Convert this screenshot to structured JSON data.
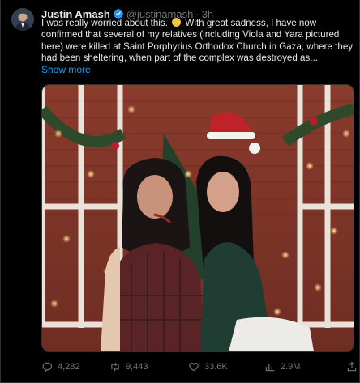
{
  "tweet": {
    "author_name": "Justin Amash",
    "handle": "@justinamash",
    "separator": "·",
    "time": "3h",
    "text_line1_a": "I was really worried about this.",
    "text_line1_b": "With great sadness, I have now confirmed that",
    "text_rest": "several of my relatives (including Viola and Yara pictured here) were killed at Saint Porphyrius Orthodox Church in Gaza, where they had been sheltering, when part of the complex was destroyed as...",
    "show_more": "Show more",
    "emoji_name": "pensive-face-emoji"
  },
  "actions": {
    "replies": "4,282",
    "retweets": "9,443",
    "likes": "33.6K",
    "views": "2.9M"
  },
  "icons": [
    "verified-badge-icon",
    "reply-icon",
    "retweet-icon",
    "like-icon",
    "views-icon",
    "share-icon"
  ],
  "colors": {
    "background": "#000000",
    "text": "#e7e9ea",
    "muted": "#71767b",
    "accent": "#1d9bf0"
  }
}
